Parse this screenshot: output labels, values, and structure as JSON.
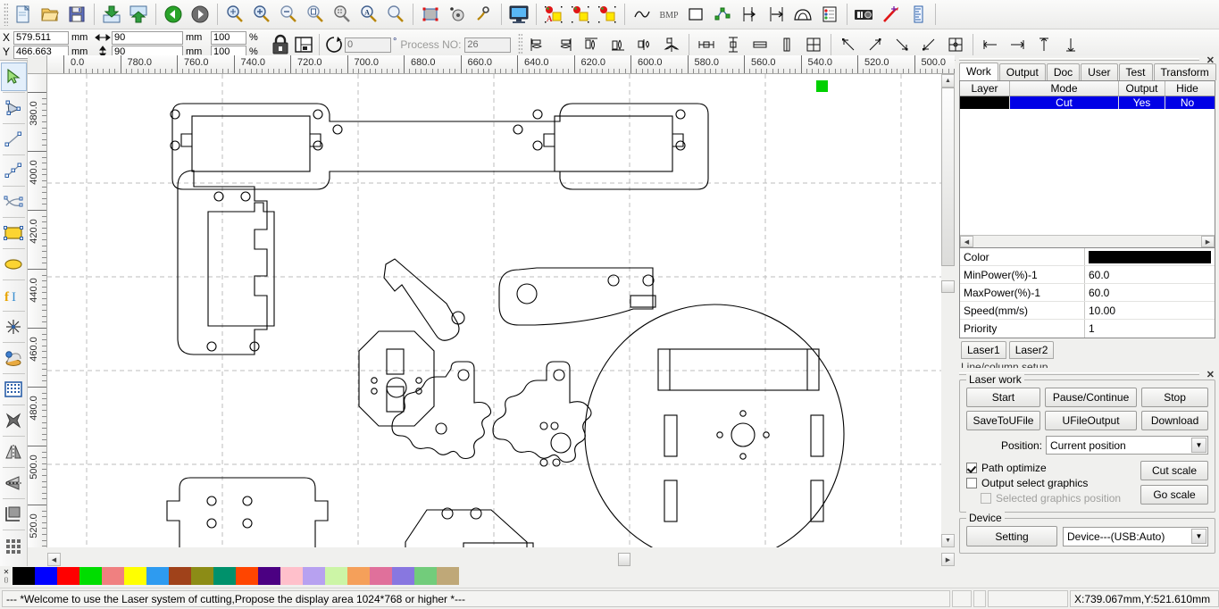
{
  "app": {
    "title": "Laser system of cutting"
  },
  "toolbar1": {
    "groups": [
      {
        "items": [
          {
            "name": "new-file-icon",
            "title": "New"
          },
          {
            "name": "open-file-icon",
            "title": "Open"
          },
          {
            "name": "save-file-icon",
            "title": "Save"
          }
        ]
      },
      {
        "items": [
          {
            "name": "import-icon",
            "title": "Import"
          },
          {
            "name": "export-icon",
            "title": "Export"
          }
        ]
      },
      {
        "items": [
          {
            "name": "undo-icon",
            "title": "Undo"
          },
          {
            "name": "redo-icon",
            "title": "Redo"
          }
        ]
      },
      {
        "items": [
          {
            "name": "zoom-pan-icon",
            "title": "Pan"
          },
          {
            "name": "zoom-in-icon",
            "title": "Zoom In"
          },
          {
            "name": "zoom-out-icon",
            "title": "Zoom Out"
          },
          {
            "name": "zoom-page-icon",
            "title": "Zoom to Page"
          },
          {
            "name": "zoom-selection-icon",
            "title": "Zoom to Selection"
          },
          {
            "name": "zoom-all-icon",
            "title": "Zoom All"
          },
          {
            "name": "zoom-window-icon",
            "title": "Zoom Window"
          }
        ]
      },
      {
        "items": [
          {
            "name": "node-edit-icon",
            "title": "Node Edit"
          },
          {
            "name": "unclosed-curve-icon",
            "title": "Unclosed Curve"
          },
          {
            "name": "curve-smooth-icon",
            "title": "Curve Smooth"
          }
        ]
      },
      {
        "items": [
          {
            "name": "preview-icon",
            "title": "Preview"
          }
        ]
      },
      {
        "items": [
          {
            "name": "set-array-text-icon",
            "title": "Set Array"
          },
          {
            "name": "group-icon",
            "title": "Group"
          },
          {
            "name": "ungroup-icon",
            "title": "UnGroup"
          }
        ]
      },
      {
        "items": [
          {
            "name": "curve-tool-icon",
            "title": "Curve"
          },
          {
            "name": "bmp-icon",
            "title": "BMP",
            "label": "BMP"
          },
          {
            "name": "rect-tool-icon",
            "title": "Rectangle"
          },
          {
            "name": "path-optimize-icon",
            "title": "Path Optimize"
          },
          {
            "name": "measure-start-icon",
            "title": "Start Point"
          },
          {
            "name": "measure-end-icon",
            "title": "End Point"
          },
          {
            "name": "cut-in-out-icon",
            "title": "Cut In/Out"
          },
          {
            "name": "layer-list-icon",
            "title": "Layer List"
          }
        ]
      },
      {
        "items": [
          {
            "name": "camera-icon",
            "title": "Camera"
          },
          {
            "name": "laser-pointer-icon",
            "title": "Laser Pointer"
          },
          {
            "name": "ruler-icon",
            "title": "Measure"
          }
        ]
      }
    ]
  },
  "toolbar2": {
    "x_label": "X",
    "y_label": "Y",
    "x_value": "579.511",
    "y_value": "466.663",
    "unit_mm": "mm",
    "width_value": "90",
    "height_value": "90",
    "scale_x": "100",
    "scale_y": "100",
    "percent": "%",
    "lock_icon": "lock-ratio-icon",
    "anchor_icon": "anchor-position-icon",
    "rotate_icon": "rotate-icon",
    "rotate_value": "0",
    "degree": "°",
    "process_label": "Process NO:",
    "process_value": "26",
    "align_tools": [
      {
        "name": "align-left-icon"
      },
      {
        "name": "align-right-icon"
      },
      {
        "name": "align-top-icon"
      },
      {
        "name": "align-bottom-icon"
      },
      {
        "name": "align-vcenter-icon"
      },
      {
        "name": "align-hcenter-icon"
      },
      {
        "name": "dist-hgap-icon"
      },
      {
        "name": "dist-vgap-icon"
      },
      {
        "name": "same-width-icon"
      },
      {
        "name": "same-height-icon"
      },
      {
        "name": "same-size-icon"
      },
      {
        "name": "array-topleft-icon"
      },
      {
        "name": "array-topright-icon"
      },
      {
        "name": "array-bottomright-icon"
      },
      {
        "name": "array-bottomleft-icon"
      },
      {
        "name": "array-center-icon"
      },
      {
        "name": "extend-left-icon"
      },
      {
        "name": "extend-right-icon"
      },
      {
        "name": "extend-top-icon"
      },
      {
        "name": "extend-bottom-icon"
      }
    ]
  },
  "left_tools": [
    {
      "name": "select-tool",
      "label": "Select",
      "selected": true
    },
    {
      "name": "node-edit-tool",
      "label": "Node Edit"
    },
    {
      "name": "line-tool",
      "label": "Line"
    },
    {
      "name": "polyline-tool",
      "label": "Polyline"
    },
    {
      "name": "bezier-tool",
      "label": "Bezier"
    },
    {
      "name": "rectangle-tool",
      "label": "Rectangle"
    },
    {
      "name": "ellipse-tool",
      "label": "Ellipse"
    },
    {
      "name": "text-tool",
      "label": "Text"
    },
    {
      "name": "spark-tool",
      "label": "Spark"
    },
    {
      "name": "capture-tool",
      "label": "Capture Image"
    },
    {
      "name": "grid-array-tool",
      "label": "Array"
    },
    {
      "name": "delete-tool",
      "label": "Delete"
    },
    {
      "name": "mirror-horizontal-tool",
      "label": "Mirror Horizontal"
    },
    {
      "name": "mirror-vertical-tool",
      "label": "Mirror Vertical"
    },
    {
      "name": "offset-tool",
      "label": "Offset"
    },
    {
      "name": "matrix-tool",
      "label": "Matrix Copy"
    }
  ],
  "rulers": {
    "h_ticks": [
      "0.0",
      "780.0",
      "760.0",
      "740.0",
      "720.0",
      "700.0",
      "680.0",
      "660.0",
      "640.0",
      "620.0",
      "600.0",
      "580.0",
      "560.0",
      "540.0",
      "520.0",
      "500.0"
    ],
    "v_ticks": [
      "380.0",
      "400.0",
      "420.0",
      "440.0",
      "460.0",
      "480.0",
      "500.0",
      "520.0"
    ]
  },
  "right_panel": {
    "tabs": [
      {
        "label": "Work",
        "active": true
      },
      {
        "label": "Output",
        "active": false
      },
      {
        "label": "Doc",
        "active": false
      },
      {
        "label": "User",
        "active": false
      },
      {
        "label": "Test",
        "active": false
      },
      {
        "label": "Transform",
        "active": false
      }
    ],
    "layer_table": {
      "headers": [
        "Layer",
        "Mode",
        "Output",
        "Hide"
      ],
      "rows": [
        {
          "layer_color": "#000000",
          "mode": "Cut",
          "output": "Yes",
          "hide": "No",
          "selected": true
        }
      ]
    },
    "parameters": [
      {
        "key": "Color",
        "value": "",
        "is_color": true,
        "color": "#000000"
      },
      {
        "key": "MinPower(%)-1",
        "value": "60.0"
      },
      {
        "key": "MaxPower(%)-1",
        "value": "60.0"
      },
      {
        "key": "Speed(mm/s)",
        "value": "10.00"
      },
      {
        "key": "Priority",
        "value": "1"
      }
    ],
    "laser_tabs": [
      "Laser1",
      "Laser2"
    ],
    "line_column_setup_label": "Line/column setup",
    "laser_work": {
      "title": "Laser work",
      "buttons_row1": [
        "Start",
        "Pause/Continue",
        "Stop"
      ],
      "buttons_row2": [
        "SaveToUFile",
        "UFileOutput",
        "Download"
      ],
      "position_label": "Position:",
      "position_value": "Current position",
      "path_optimize_label": "Path optimize",
      "path_optimize_checked": true,
      "output_select_label": "Output select graphics",
      "output_select_checked": false,
      "selected_graphics_label": "Selected graphics position",
      "selected_graphics_checked": false,
      "selected_graphics_disabled": true,
      "cut_scale_label": "Cut scale",
      "go_scale_label": "Go scale"
    },
    "device": {
      "title": "Device",
      "setting_label": "Setting",
      "device_value": "Device---(USB:Auto)"
    }
  },
  "palette": {
    "colors": [
      "#000000",
      "#0000ff",
      "#ff0000",
      "#00dd00",
      "#f08080",
      "#ffff00",
      "#2e9bf0",
      "#a0421a",
      "#8c8c16",
      "#00916b",
      "#ff4500",
      "#4b0082",
      "#ffc0cb",
      "#b7a1f0",
      "#ccf5a6",
      "#f5a05a",
      "#e0709b",
      "#8877e0",
      "#72cc7b",
      "#bfa878"
    ],
    "close_icon": "palette-close-icon"
  },
  "status": {
    "message": "--- *Welcome to use the Laser system of cutting,Propose the display area 1024*768 or higher *---",
    "coords": "X:739.067mm,Y:521.610mm"
  },
  "canvas_shapes": {
    "description": "Vector laser cut layout of robot chassis parts",
    "origin_marker_color": "#00d000"
  }
}
